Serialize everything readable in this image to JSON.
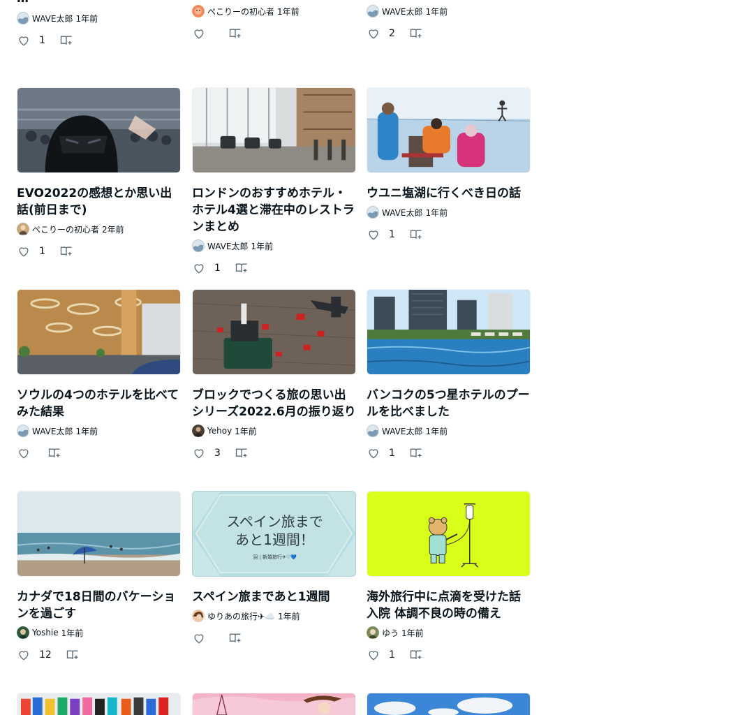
{
  "cards": [
    {
      "title": "…",
      "author": "WAVE太郎",
      "time": "1年前",
      "likes": "1",
      "avatar": "wave-avatar"
    },
    {
      "title": "",
      "author": "ぺこりーの初心者",
      "time": "1年前",
      "likes": "",
      "avatar": "orange-avatar"
    },
    {
      "title": "",
      "author": "WAVE太郎",
      "time": "1年前",
      "likes": "2",
      "avatar": "wave-avatar"
    },
    {
      "title": "EVO2022の感想とか思い出話(前日まで)",
      "author": "ぺこりーの初心者",
      "time": "2年前",
      "likes": "1",
      "avatar": "person-avatar",
      "image": "darth-vader-photo"
    },
    {
      "title": "ロンドンのおすすめホテル・ホテル4選と滞在中のレストランまとめ",
      "author": "WAVE太郎",
      "time": "1年前",
      "likes": "1",
      "avatar": "wave-avatar",
      "image": "hotel-lobby-photo"
    },
    {
      "title": "ウユニ塩湖に行くべき日の話",
      "author": "WAVE太郎",
      "time": "1年前",
      "likes": "1",
      "avatar": "wave-avatar",
      "image": "salt-flat-photo"
    },
    {
      "title": "ソウルの4つのホテルを比べてみた結果",
      "author": "WAVE太郎",
      "time": "1年前",
      "likes": "",
      "avatar": "wave-avatar",
      "image": "hotel-reception-photo"
    },
    {
      "title": "ブロックでつくる旅の思い出シリーズ2022.6月の振り返り",
      "author": "Yehoy",
      "time": "1年前",
      "likes": "3",
      "avatar": "dark-avatar",
      "image": "lego-photo"
    },
    {
      "title": "バンコクの5つ星ホテルのプールを比べました",
      "author": "WAVE太郎",
      "time": "1年前",
      "likes": "1",
      "avatar": "wave-avatar",
      "image": "pool-photo"
    },
    {
      "title": "カナダで18日間のバケーションを過ごす",
      "author": "Yoshie",
      "time": "1年前",
      "likes": "12",
      "avatar": "green-avatar",
      "image": "beach-photo"
    },
    {
      "title": "スペイン旅まであと1週間",
      "author": "ゆりあの旅行✈☁️",
      "time": "1年前",
      "likes": "",
      "avatar": "woman-avatar",
      "image": "spain-banner",
      "image_text_1": "スペイン旅まで",
      "image_text_2": "あと1週間！",
      "image_caption": "羽 | 新婚旅行✈♡💙"
    },
    {
      "title": "海外旅行中に点滴を受けた話 入院 体調不良の時の備え",
      "author": "ゆう",
      "time": "1年前",
      "likes": "1",
      "avatar": "nature-avatar",
      "image": "bear-drip-illustration"
    },
    {
      "title": "",
      "author": "",
      "time": "",
      "likes": "",
      "image": "swimwear-photo"
    },
    {
      "title": "",
      "author": "",
      "time": "",
      "likes": "",
      "image": "paris-illustration"
    },
    {
      "title": "",
      "author": "",
      "time": "",
      "likes": "",
      "image": "sky-photo"
    }
  ]
}
